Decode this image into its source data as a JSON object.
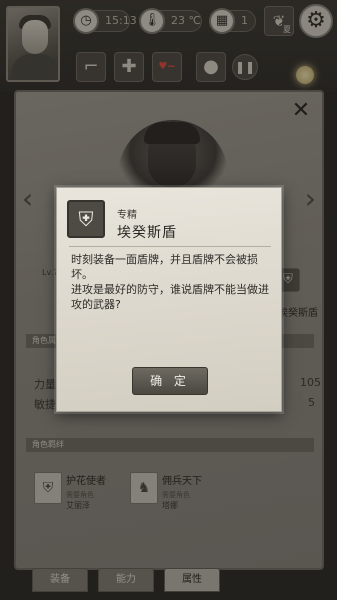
{
  "hud": {
    "time": "15:13",
    "temperature": "23 ℃",
    "day": "1",
    "season": "夏"
  },
  "card": {
    "level": "Lv.7",
    "skill_label_right": "埃癸斯盾",
    "section_attr": "角色属性",
    "section_bonds": "角色羁绊",
    "stats": {
      "str_label": "力量",
      "agi_label": "敏捷",
      "str_value": "105",
      "agi_value": "5"
    },
    "bonds": [
      {
        "name": "护花使者",
        "need": "需要角色",
        "who": "艾丽泽"
      },
      {
        "name": "佣兵天下",
        "need": "需要角色",
        "who": "塔娜"
      }
    ],
    "tabs": [
      "装备",
      "能力",
      "属性"
    ]
  },
  "modal": {
    "type": "专精",
    "name": "埃癸斯盾",
    "desc_1": "时刻装备一面盾牌，并且盾牌不会被损坏。",
    "desc_2": "进攻是最好的防守，谁说盾牌不能当做进攻的武器?",
    "ok_label": "确 定"
  }
}
